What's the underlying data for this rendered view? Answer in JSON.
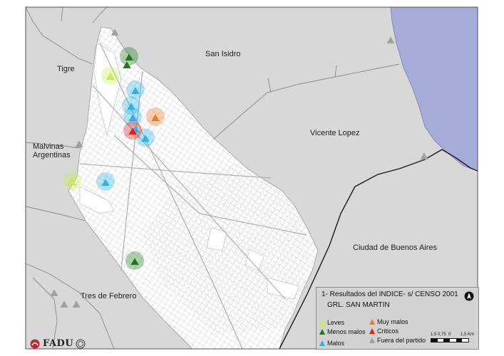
{
  "places": {
    "san_isidro": "San Isidro",
    "tigre": "Tigre",
    "malvinas_1": "Malvinas",
    "malvinas_2": "Argentinas",
    "vicente_lopez": "Vicente Lopez",
    "ciudad": "Ciudad de Buenos Aires",
    "tres_de_febrero": "Tres de Febrero"
  },
  "legend": {
    "title": "1- Resultados del INDICE- s/ CENSO 2001",
    "subtitle": "GRL. SAN MARTIN",
    "north": "N",
    "items": [
      {
        "label": "Leves",
        "color": "#c8f050"
      },
      {
        "label": "Menos malos",
        "color": "#1a7a1a"
      },
      {
        "label": "Malos",
        "color": "#2ab4ee"
      },
      {
        "label": "Muy malos",
        "color": "#f07820"
      },
      {
        "label": "Criticos",
        "color": "#e81e1e"
      },
      {
        "label": "Fuera del partido",
        "color": "#a0a0a0"
      }
    ],
    "scale": {
      "labels": [
        "1,5",
        "0,75",
        "0",
        "1,5 Km"
      ]
    }
  },
  "logo": {
    "text": "FADU"
  },
  "colors": {
    "land": "#d8d8d8",
    "district": "#ffffff",
    "river": "#a6acd8",
    "streets": "#c4c4c4",
    "boundary": "#1a1a1a"
  }
}
